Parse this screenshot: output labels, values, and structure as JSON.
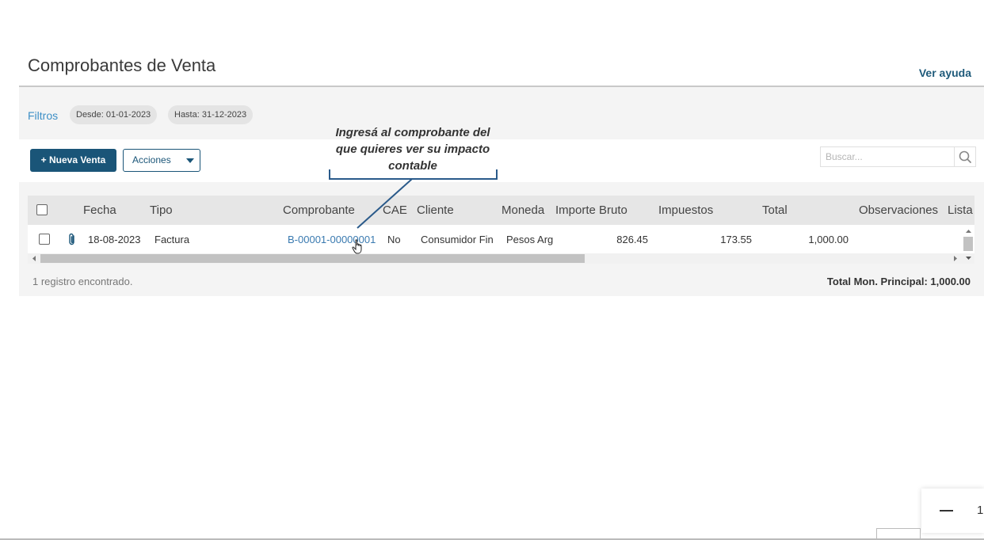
{
  "header": {
    "title": "Comprobantes de Venta",
    "help_link": "Ver ayuda"
  },
  "filters": {
    "label": "Filtros",
    "chips": [
      "Desde: 01-01-2023",
      "Hasta: 31-12-2023"
    ]
  },
  "toolbar": {
    "new_label": "+ Nueva Venta",
    "actions_label": "Acciones",
    "search_placeholder": "Buscar..."
  },
  "callout": {
    "text": "Ingresá al comprobante del que quieres ver su impacto contable"
  },
  "table": {
    "columns": [
      "Fecha",
      "Tipo",
      "Comprobante",
      "CAE",
      "Cliente",
      "Moneda",
      "Importe Bruto",
      "Impuestos",
      "Total",
      "Observaciones",
      "Lista"
    ],
    "rows": [
      {
        "fecha": "18-08-2023",
        "tipo": "Factura",
        "comprobante": "B-00001-00000001",
        "cae": "No",
        "cliente": "Consumidor Fin",
        "moneda": "Pesos Arg",
        "importe_bruto": "826.45",
        "impuestos": "173.55",
        "total": "1,000.00",
        "observaciones": "",
        "lista": ""
      }
    ]
  },
  "footer": {
    "count_text": "1 registro encontrado.",
    "total_text": "Total Mon. Principal: 1,000.00"
  },
  "zoom_widget": {
    "value": "1"
  },
  "colors": {
    "primary": "#1a5578",
    "link": "#3a7ab0",
    "header_bg": "#e6e6e6",
    "panel_bg": "#f4f4f4"
  }
}
